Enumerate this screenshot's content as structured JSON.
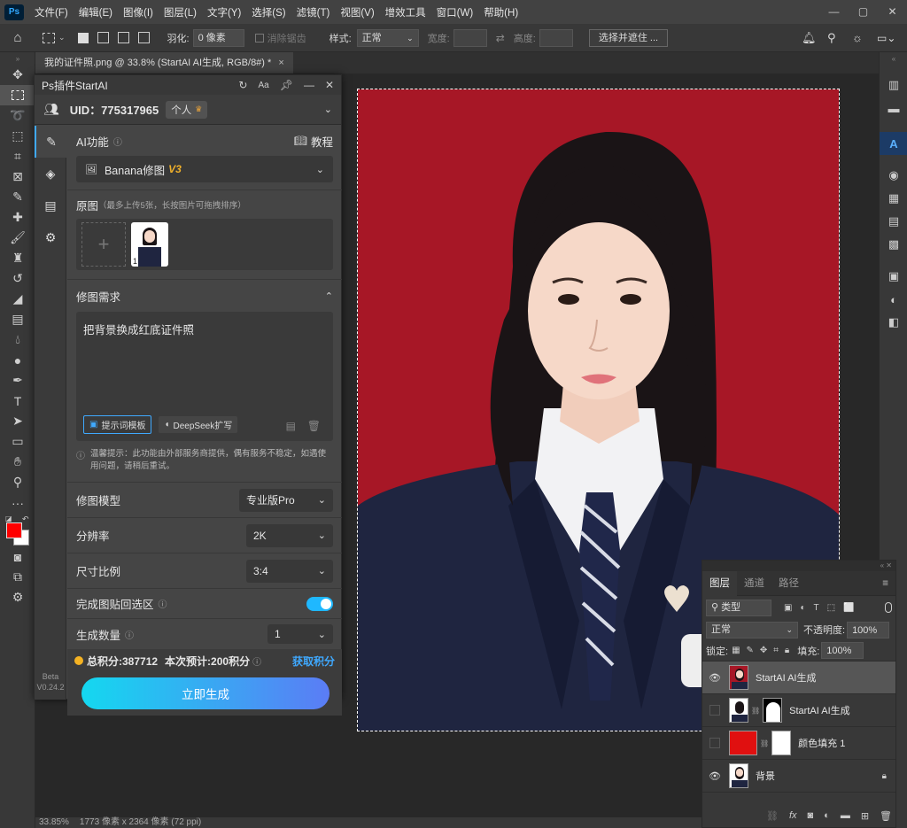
{
  "menubar": {
    "logo": "Ps",
    "items": [
      "文件(F)",
      "编辑(E)",
      "图像(I)",
      "图层(L)",
      "文字(Y)",
      "选择(S)",
      "滤镜(T)",
      "视图(V)",
      "增效工具",
      "窗口(W)",
      "帮助(H)"
    ]
  },
  "options": {
    "feather_label": "羽化:",
    "feather_value": "0 像素",
    "antialias": "消除锯齿",
    "style_label": "样式:",
    "style_value": "正常",
    "width_label": "宽度:",
    "height_label": "高度:",
    "select_mask": "选择并遮住 ..."
  },
  "doc_tab": {
    "title": "我的证件照.png @ 33.8% (StartAI AI生成, RGB/8#) *",
    "close": "×"
  },
  "plugin": {
    "title": "Ps插件StartAI",
    "uid": "UID：775317965",
    "plan": "个人",
    "ai_func_label": "AI功能",
    "tutorial": "教程",
    "func_select": "Banana修图",
    "func_badge": "V3",
    "orig_label": "原图",
    "orig_hint": "（最多上传5张，长按图片可拖拽排序）",
    "thumb_index": "1",
    "need_label": "修图需求",
    "prompt": "把背景换成红底证件照",
    "template_btn": "提示词模板",
    "deepseek_btn": "DeepSeek扩写",
    "tip": "温馨提示：此功能由外部服务商提供，偶有服务不稳定，如遇使用问题，请稍后重试。",
    "model_label": "修图模型",
    "model_value": "专业版Pro",
    "res_label": "分辨率",
    "res_value": "2K",
    "ratio_label": "尺寸比例",
    "ratio_value": "3:4",
    "paste_label": "完成图贴回选区",
    "count_label": "生成数量",
    "count_value": "1",
    "points": "总积分:387712",
    "estimate": "本次预计:200积分",
    "get_points": "获取积分",
    "generate": "立即生成",
    "beta": "Beta",
    "version": "V0.24.2"
  },
  "layers_panel": {
    "tabs": [
      "图层",
      "通道",
      "路径"
    ],
    "filter": "类型",
    "blend": "正常",
    "opacity_label": "不透明度:",
    "opacity": "100%",
    "lock_label": "锁定:",
    "fill_label": "填充:",
    "fill": "100%",
    "layers": [
      {
        "name": "StartAI AI生成",
        "visible": true,
        "selected": true
      },
      {
        "name": "StartAI AI生成",
        "visible": false,
        "selected": false
      },
      {
        "name": "颜色填充 1",
        "visible": false,
        "selected": false
      },
      {
        "name": "背景",
        "visible": true,
        "selected": false
      }
    ]
  },
  "status": {
    "zoom": "33.85%",
    "size": "1773 像素 x 2364 像素 (72 ppi)"
  },
  "colors": {
    "fg": "#ff0000",
    "bg": "#ffffff",
    "photo_bg": "#a71726"
  }
}
